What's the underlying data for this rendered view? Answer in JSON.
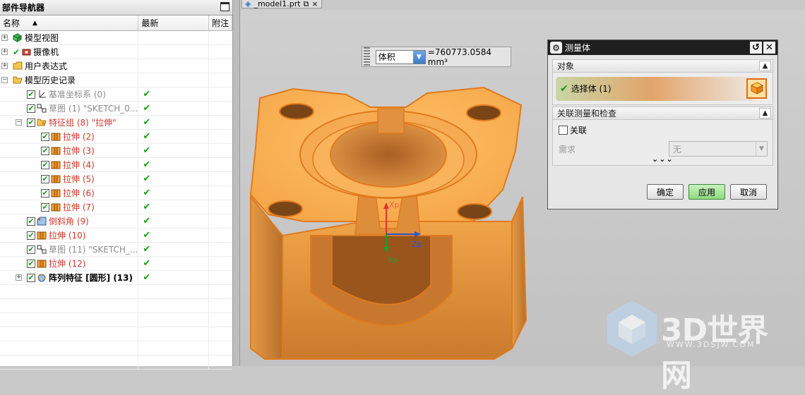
{
  "navigator": {
    "title": "部件导航器",
    "columns": [
      "名称",
      "最新",
      "附注"
    ],
    "rows": [
      {
        "label": "模型视图",
        "icon": "model-views-icon",
        "style": "normal",
        "latest": ""
      },
      {
        "label": "摄像机",
        "icon": "camera-icon",
        "style": "normal",
        "latest": ""
      },
      {
        "label": "用户表达式",
        "icon": "folder-icon",
        "style": "normal",
        "latest": ""
      },
      {
        "label": "模型历史记录",
        "icon": "folder-open-icon",
        "style": "normal",
        "latest": ""
      },
      {
        "label": "基准坐标系 (0)",
        "icon": "datum-csys-icon",
        "style": "gray",
        "latest": "✔"
      },
      {
        "label": "草图 (1) \"SKETCH_0...",
        "icon": "sketch-icon",
        "style": "gray",
        "latest": "✔"
      },
      {
        "label": "特征组 (8) \"拉伸\"",
        "icon": "feature-group-icon",
        "style": "red",
        "latest": "✔"
      },
      {
        "label": "拉伸 (2)",
        "icon": "extrude-icon",
        "style": "red",
        "latest": "✔"
      },
      {
        "label": "拉伸 (3)",
        "icon": "extrude-icon",
        "style": "red",
        "latest": "✔"
      },
      {
        "label": "拉伸 (4)",
        "icon": "extrude-icon",
        "style": "red",
        "latest": "✔"
      },
      {
        "label": "拉伸 (5)",
        "icon": "extrude-icon",
        "style": "red",
        "latest": "✔"
      },
      {
        "label": "拉伸 (6)",
        "icon": "extrude-icon",
        "style": "red",
        "latest": "✔"
      },
      {
        "label": "拉伸 (7)",
        "icon": "extrude-icon",
        "style": "red",
        "latest": "✔"
      },
      {
        "label": "倒斜角 (9)",
        "icon": "chamfer-icon",
        "style": "red",
        "latest": "✔"
      },
      {
        "label": "拉伸 (10)",
        "icon": "extrude-icon",
        "style": "red",
        "latest": "✔"
      },
      {
        "label": "草图 (11) \"SKETCH_...",
        "icon": "sketch-icon",
        "style": "gray",
        "latest": "✔"
      },
      {
        "label": "拉伸 (12)",
        "icon": "extrude-icon",
        "style": "red",
        "latest": "✔"
      },
      {
        "label": "阵列特征 [圆形] (13)",
        "icon": "pattern-icon",
        "style": "bold",
        "latest": "✔"
      }
    ]
  },
  "tab": {
    "label": "_model1.prt"
  },
  "readout": {
    "type": "体积",
    "value": "=760773.0584 mm³"
  },
  "dialog": {
    "title": "测量体",
    "section_object": "对象",
    "select_body": "选择体 (1)",
    "section_assoc": "关联测量和检查",
    "assoc_label": "关联",
    "requirement_label": "需求",
    "requirement_value": "无",
    "ok": "确定",
    "apply": "应用",
    "cancel": "取消"
  },
  "triad": {
    "x": "Xp",
    "y": "Yp",
    "z": "Zp"
  },
  "watermark": {
    "text": "3D世界网",
    "url": "WWW.3DSJW.COM"
  },
  "colors": {
    "accent": "#f4a646",
    "apply_green": "#9be08c",
    "titlebar": "#1f1f1f"
  }
}
